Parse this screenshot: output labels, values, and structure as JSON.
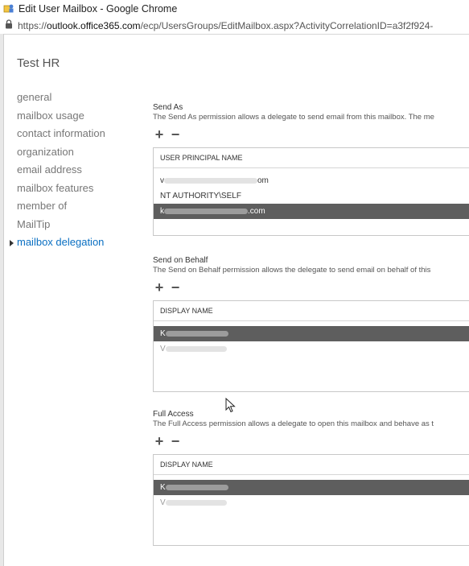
{
  "window": {
    "title": "Edit User Mailbox - Google Chrome",
    "url_scheme": "https://",
    "url_host": "outlook.office365.com",
    "url_path": "/ecp/UsersGroups/EditMailbox.aspx?ActivityCorrelationID=a3f2f924-"
  },
  "page": {
    "title": "Test HR"
  },
  "nav": {
    "items": [
      "general",
      "mailbox usage",
      "contact information",
      "organization",
      "email address",
      "mailbox features",
      "member of",
      "MailTip",
      "mailbox delegation"
    ],
    "selected_index": 8
  },
  "send_as": {
    "title": "Send As",
    "description": "The Send As permission allows a delegate to send email from this mailbox. The me",
    "add_label": "+",
    "remove_label": "−",
    "column_header": "USER PRINCIPAL NAME",
    "rows": [
      {
        "prefix": "v",
        "suffix": "om"
      },
      {
        "text": "NT AUTHORITY\\SELF"
      },
      {
        "prefix": "k",
        "suffix": ".com"
      }
    ]
  },
  "send_on_behalf": {
    "title": "Send on Behalf",
    "description": "The Send on Behalf permission allows the delegate to send email on behalf of this",
    "add_label": "+",
    "remove_label": "−",
    "column_header": "DISPLAY NAME",
    "rows": [
      {
        "prefix": "K"
      },
      {
        "prefix": "V"
      }
    ]
  },
  "full_access": {
    "title": "Full Access",
    "description": "The Full Access permission allows a delegate to open this mailbox and behave as t",
    "add_label": "+",
    "remove_label": "−",
    "column_header": "DISPLAY NAME",
    "rows": [
      {
        "prefix": "K"
      },
      {
        "prefix": "V"
      }
    ]
  },
  "colors": {
    "selected_nav": "#0a6fc2",
    "selected_row": "#5e5e5e",
    "border": "#c8c8c8"
  }
}
